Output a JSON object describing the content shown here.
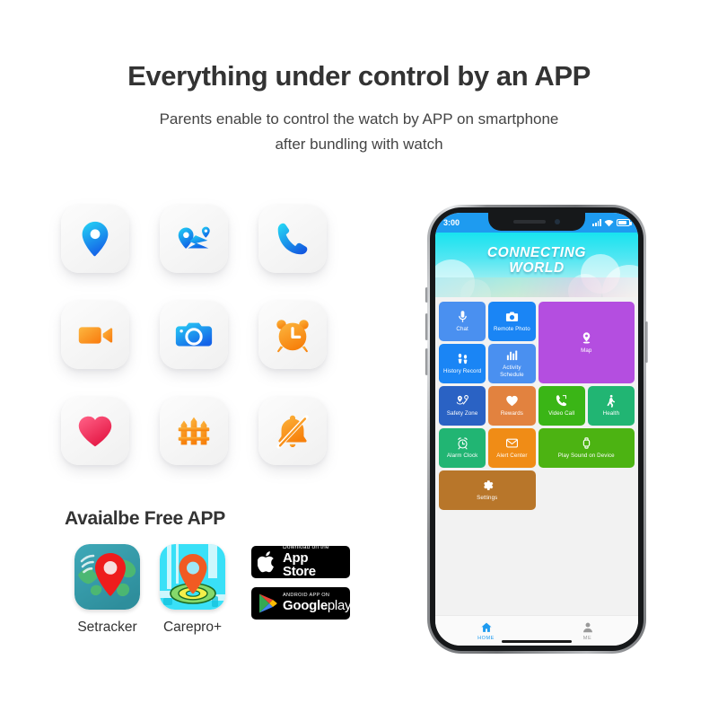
{
  "header": {
    "headline": "Everything under control by an APP",
    "subline_1": "Parents enable to control the watch by APP on smartphone",
    "subline_2": "after bundling with watch"
  },
  "feature_icons": [
    {
      "name": "location-pin-icon",
      "label": "Location"
    },
    {
      "name": "route-tracking-icon",
      "label": "Route tracking"
    },
    {
      "name": "phone-call-icon",
      "label": "Phone call"
    },
    {
      "name": "video-camera-icon",
      "label": "Video call"
    },
    {
      "name": "camera-icon",
      "label": "Remote camera"
    },
    {
      "name": "alarm-clock-icon",
      "label": "Alarm clock"
    },
    {
      "name": "heart-icon",
      "label": "Heart rate"
    },
    {
      "name": "fence-icon",
      "label": "Geo fence"
    },
    {
      "name": "bell-off-icon",
      "label": "Silent mode"
    }
  ],
  "apps": {
    "title": "Avaialbe Free APP",
    "items": [
      {
        "label": "Setracker",
        "icon": "setracker-app-icon"
      },
      {
        "label": "Carepro+",
        "icon": "carepro-app-icon"
      }
    ],
    "badges": [
      {
        "name": "app-store-badge",
        "top": "Download on the",
        "bottom": "App Store"
      },
      {
        "name": "google-play-badge",
        "top": "ANDROID APP ON",
        "bottom_bold": "Google",
        "bottom_light": "play"
      }
    ]
  },
  "phone": {
    "status": {
      "time": "3:00",
      "signal": "signal-bars-icon",
      "wifi": "wifi-icon",
      "battery": "battery-icon"
    },
    "hero": {
      "line1": "CONNECTING",
      "line2": "WORLD"
    },
    "tiles": [
      {
        "label": "Chat",
        "icon": "microphone-icon",
        "color": "#4a90f0"
      },
      {
        "label": "Remote Photo",
        "icon": "camera-icon",
        "color": "#1a85f5"
      },
      {
        "label": "Map",
        "icon": "map-pin-icon",
        "color": "#b44ee0"
      },
      {
        "label": "History Record",
        "icon": "footprints-icon",
        "color": "#1a85f5"
      },
      {
        "label": "Activity Schedule",
        "icon": "bar-chart-icon",
        "color": "#4a90f0"
      },
      {
        "label": "Safety Zone",
        "icon": "safety-zone-icon",
        "color": "#2a62c4"
      },
      {
        "label": "Rewards",
        "icon": "heart-icon",
        "color": "#e2823f"
      },
      {
        "label": "Video Call",
        "icon": "phone-call-icon",
        "color": "#3ab516"
      },
      {
        "label": "Health",
        "icon": "walking-person-icon",
        "color": "#21b573"
      },
      {
        "label": "Alarm Clock",
        "icon": "alarm-clock-icon",
        "color": "#21b573"
      },
      {
        "label": "Alert Center",
        "icon": "envelope-icon",
        "color": "#f08c16"
      },
      {
        "label": "Play Sound on Device",
        "icon": "watch-icon",
        "color": "#4cb312"
      },
      {
        "label": "Settings",
        "icon": "gear-icon",
        "color": "#b8762a"
      }
    ],
    "tabs": [
      {
        "label": "HOME",
        "icon": "home-icon",
        "active": true
      },
      {
        "label": "ME",
        "icon": "person-icon",
        "active": false
      }
    ]
  },
  "colors": {
    "accent_blue": "#1e9bf0",
    "hero_cyan": "#18e3ef",
    "text_dark": "#333333"
  }
}
